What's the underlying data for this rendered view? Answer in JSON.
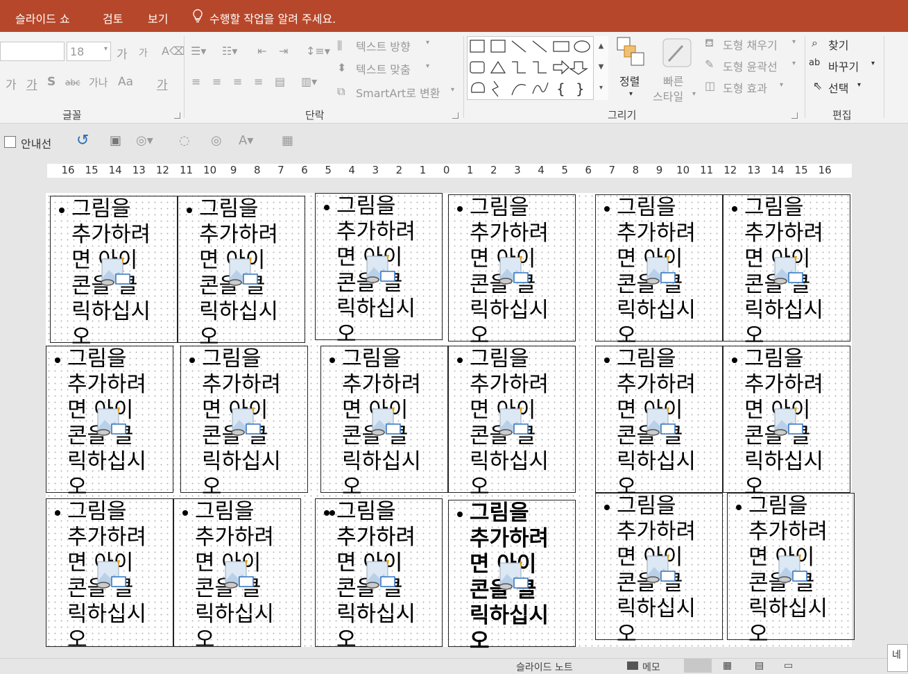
{
  "menubar": {
    "tabs": [
      "슬라이드 쇼",
      "검토",
      "보기"
    ],
    "tell_me": "수행할 작업을 알려 주세요."
  },
  "ribbon": {
    "font": {
      "size_value": "18",
      "grow": "가",
      "shrink": "가",
      "row2": [
        "가",
        "가",
        "S",
        "abc",
        "가나",
        "Aa",
        "가"
      ],
      "label": "글꼴"
    },
    "paragraph": {
      "text_direction": "텍스트 방향",
      "align_text": "텍스트 맞춤",
      "smartart": "SmartArt로 변환",
      "label": "단락"
    },
    "drawing": {
      "arrange": "정렬",
      "quick_styles_line1": "빠른",
      "quick_styles_line2": "스타일",
      "shape_fill": "도형 채우기",
      "shape_outline": "도형 윤곽선",
      "shape_effects": "도형 효과",
      "label": "그리기"
    },
    "editing": {
      "find": "찾기",
      "replace": "바꾸기",
      "select": "선택",
      "label": "편집"
    }
  },
  "quickbar": {
    "guides": "안내선"
  },
  "ruler": [
    "16",
    "15",
    "14",
    "13",
    "12",
    "11",
    "10",
    "9",
    "8",
    "7",
    "6",
    "5",
    "4",
    "3",
    "2",
    "1",
    "0",
    "1",
    "2",
    "3",
    "4",
    "5",
    "6",
    "7",
    "8",
    "9",
    "10",
    "11",
    "12",
    "13",
    "14",
    "15",
    "16"
  ],
  "placeholder_text": [
    "그림을",
    "추가하려",
    "면 아이",
    "콘을 클",
    "릭하십시",
    "오"
  ],
  "statusbar": {
    "notes": "슬라이드 노트",
    "comments": "메모"
  },
  "hint_text": "네",
  "colors": {
    "accent": "#b7472a",
    "ribbon": "#f3f3f3"
  }
}
